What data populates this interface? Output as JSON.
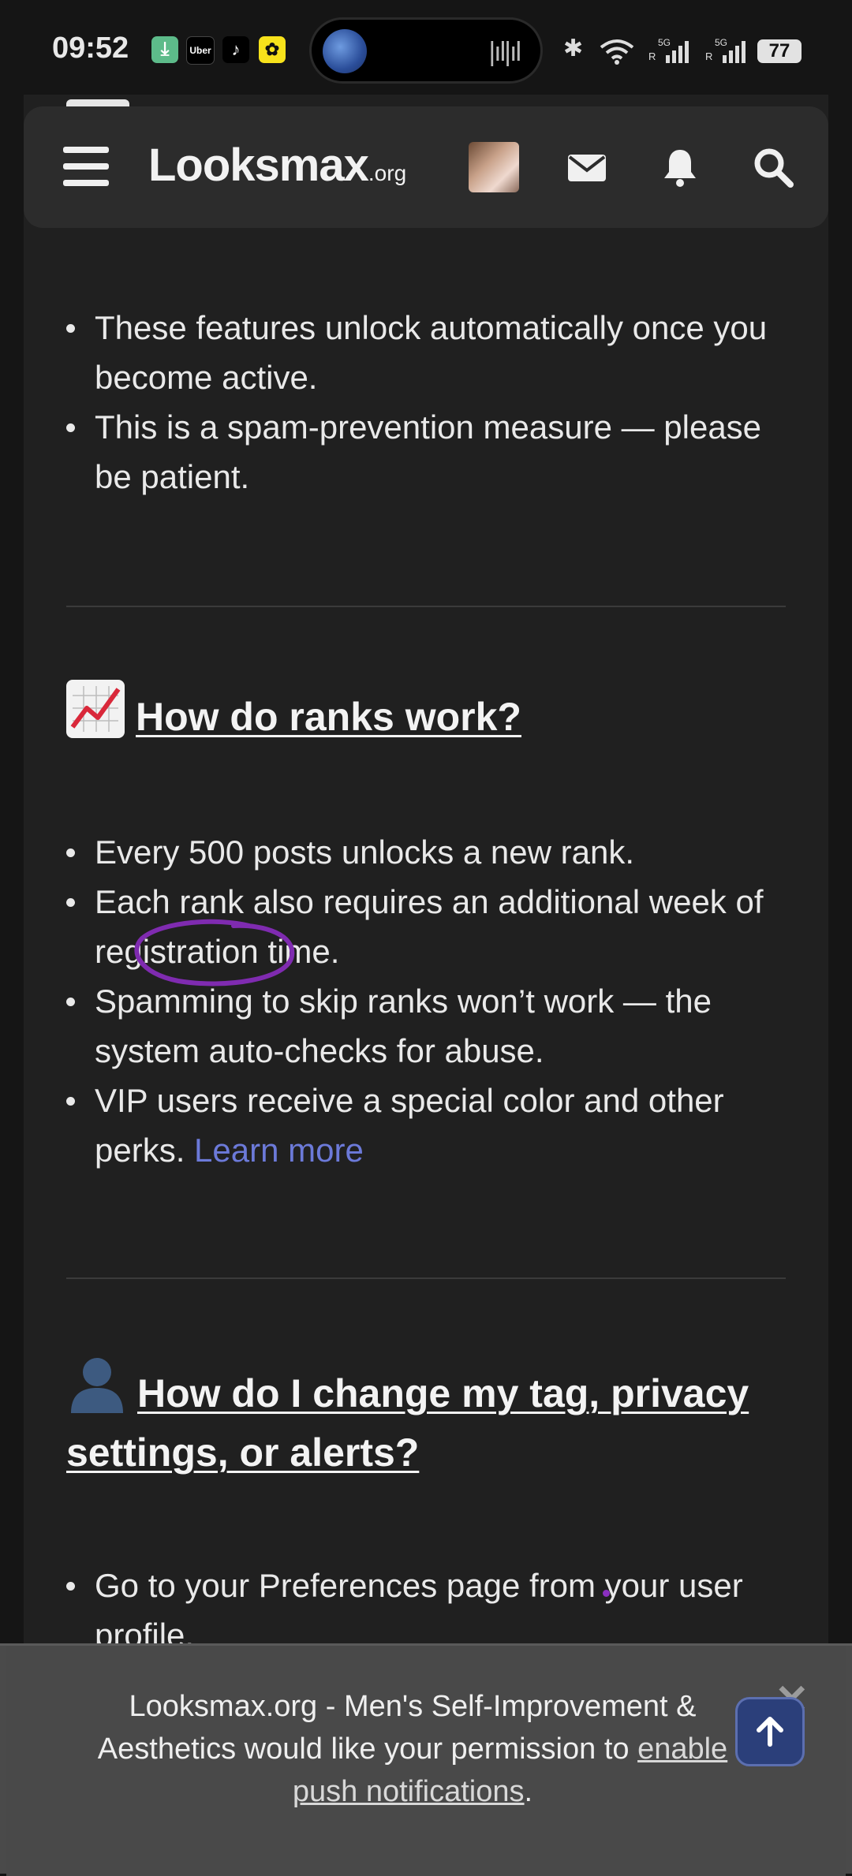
{
  "status_bar": {
    "time": "09:52",
    "battery": "77",
    "notification_icons": [
      "download-icon",
      "uber-icon",
      "tiktok-icon",
      "snapchat-icon"
    ],
    "uber_label": "Uber",
    "signal_labels": [
      "5G R",
      "5G R"
    ]
  },
  "header": {
    "logo_main": "Looksmax",
    "logo_suffix": ".org"
  },
  "sections": {
    "intro_bullets": [
      "These features unlock automatically once you become active.",
      "This is a spam-prevention measure — please be patient."
    ],
    "ranks": {
      "heading": "How do ranks work?",
      "bullets": [
        "Every 500 posts unlocks a new rank.",
        "Each rank also requires an additional week of registration time.",
        "Spamming to skip ranks won’t work — the system auto-checks for abuse.",
        "VIP users receive a special color and other perks."
      ],
      "learn_more": "Learn more"
    },
    "tags": {
      "heading": "How do I change my tag, privacy settings, or alerts?",
      "bullets": [
        "Go to your Preferences page from your user profile."
      ]
    }
  },
  "notification_banner": {
    "text_before": "Looksmax.org - Men's Self-Improvement & Aesthetics would like your permission to ",
    "link": "enable push notifications",
    "text_after": "."
  },
  "colors": {
    "background": "#202020",
    "header": "#2c2c2c",
    "link": "#6c7ad9",
    "annotation": "#7f2bb0",
    "scroll_button": "#2b3f7a"
  }
}
